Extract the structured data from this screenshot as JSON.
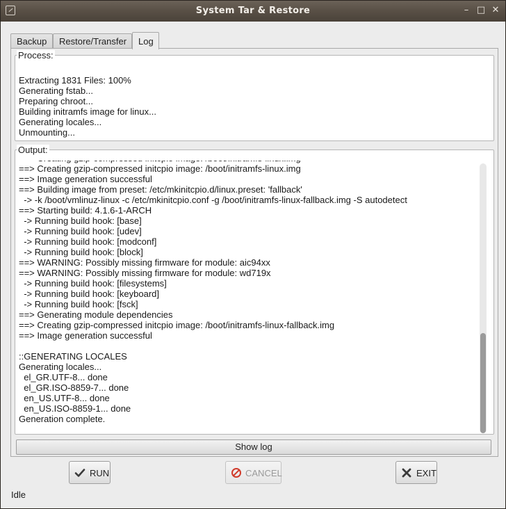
{
  "window": {
    "title": "System Tar & Restore",
    "minimize_glyph": "–",
    "maximize_glyph": "□",
    "close_glyph": "✕"
  },
  "tabs": [
    {
      "label": "Backup",
      "active": false
    },
    {
      "label": "Restore/Transfer",
      "active": false
    },
    {
      "label": "Log",
      "active": true
    }
  ],
  "process": {
    "label": "Process:",
    "lines": [
      "Extracting 1831 Files: 100%",
      "Generating fstab...",
      "Preparing chroot...",
      "Building initramfs image for linux...",
      "Generating locales...",
      "Unmounting..."
    ]
  },
  "output": {
    "label": "Output:",
    "lines": [
      "==> Creating gzip-compressed initcpio image: /boot/initramfs-linux.img",
      "==> Creating gzip-compressed initcpio image: /boot/initramfs-linux.img",
      "==> Image generation successful",
      "==> Building image from preset: /etc/mkinitcpio.d/linux.preset: 'fallback'",
      "  -> -k /boot/vmlinuz-linux -c /etc/mkinitcpio.conf -g /boot/initramfs-linux-fallback.img -S autodetect",
      "==> Starting build: 4.1.6-1-ARCH",
      "  -> Running build hook: [base]",
      "  -> Running build hook: [udev]",
      "  -> Running build hook: [modconf]",
      "  -> Running build hook: [block]",
      "==> WARNING: Possibly missing firmware for module: aic94xx",
      "==> WARNING: Possibly missing firmware for module: wd719x",
      "  -> Running build hook: [filesystems]",
      "  -> Running build hook: [keyboard]",
      "  -> Running build hook: [fsck]",
      "==> Generating module dependencies",
      "==> Creating gzip-compressed initcpio image: /boot/initramfs-linux-fallback.img",
      "==> Image generation successful",
      "",
      "::GENERATING LOCALES",
      "Generating locales...",
      "  el_GR.UTF-8... done",
      "  el_GR.ISO-8859-7... done",
      "  en_US.UTF-8... done",
      "  en_US.ISO-8859-1... done",
      "Generation complete."
    ]
  },
  "show_log_button": {
    "label": "Show log"
  },
  "buttons": {
    "run": {
      "label": "RUN",
      "icon": "checkmark-icon",
      "enabled": true
    },
    "cancel": {
      "label": "CANCEL",
      "icon": "cancel-icon",
      "enabled": false
    },
    "exit": {
      "label": "EXIT",
      "icon": "close-x-icon",
      "enabled": true
    }
  },
  "status": {
    "text": "Idle"
  },
  "colors": {
    "titlebar": "#5a5147",
    "window_bg": "#ececec",
    "field_bg": "#ffffff",
    "cancel_icon_red": "#d03a2a"
  }
}
